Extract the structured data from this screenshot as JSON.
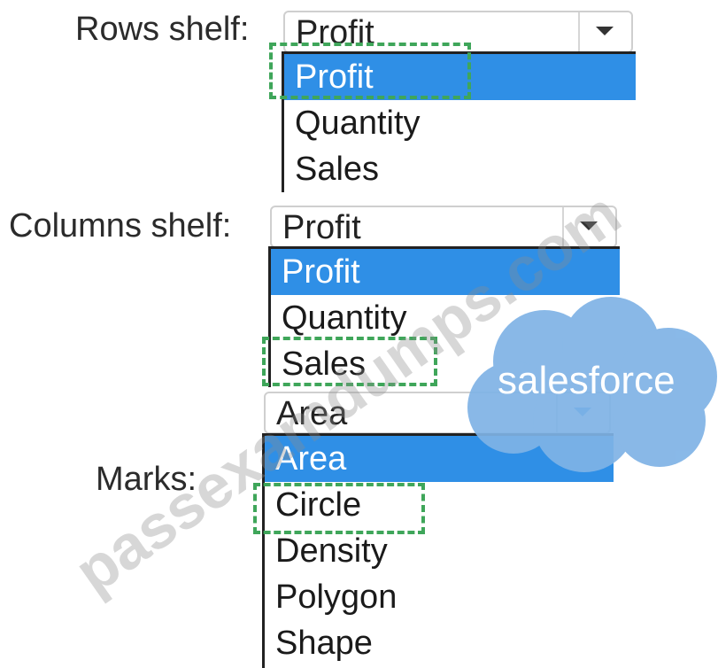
{
  "rows_shelf": {
    "label": "Rows shelf:",
    "selected": "Profit",
    "options": [
      "Profit",
      "Quantity",
      "Sales"
    ],
    "highlighted_index": 0
  },
  "columns_shelf": {
    "label": "Columns shelf:",
    "selected": "Profit",
    "options": [
      "Profit",
      "Quantity",
      "Sales"
    ],
    "highlighted_index": 0
  },
  "marks": {
    "label": "Marks:",
    "selected": "Area",
    "options": [
      "Area",
      "Circle",
      "Density",
      "Polygon",
      "Shape"
    ],
    "highlighted_index": 0
  },
  "overlay": {
    "logo_text": "salesforce",
    "watermark": "passexamdumps.com"
  },
  "colors": {
    "selection_blue": "#2f8fe6",
    "dashed_green": "#3fa65a",
    "logo_cloud": "#7fb3e6"
  }
}
